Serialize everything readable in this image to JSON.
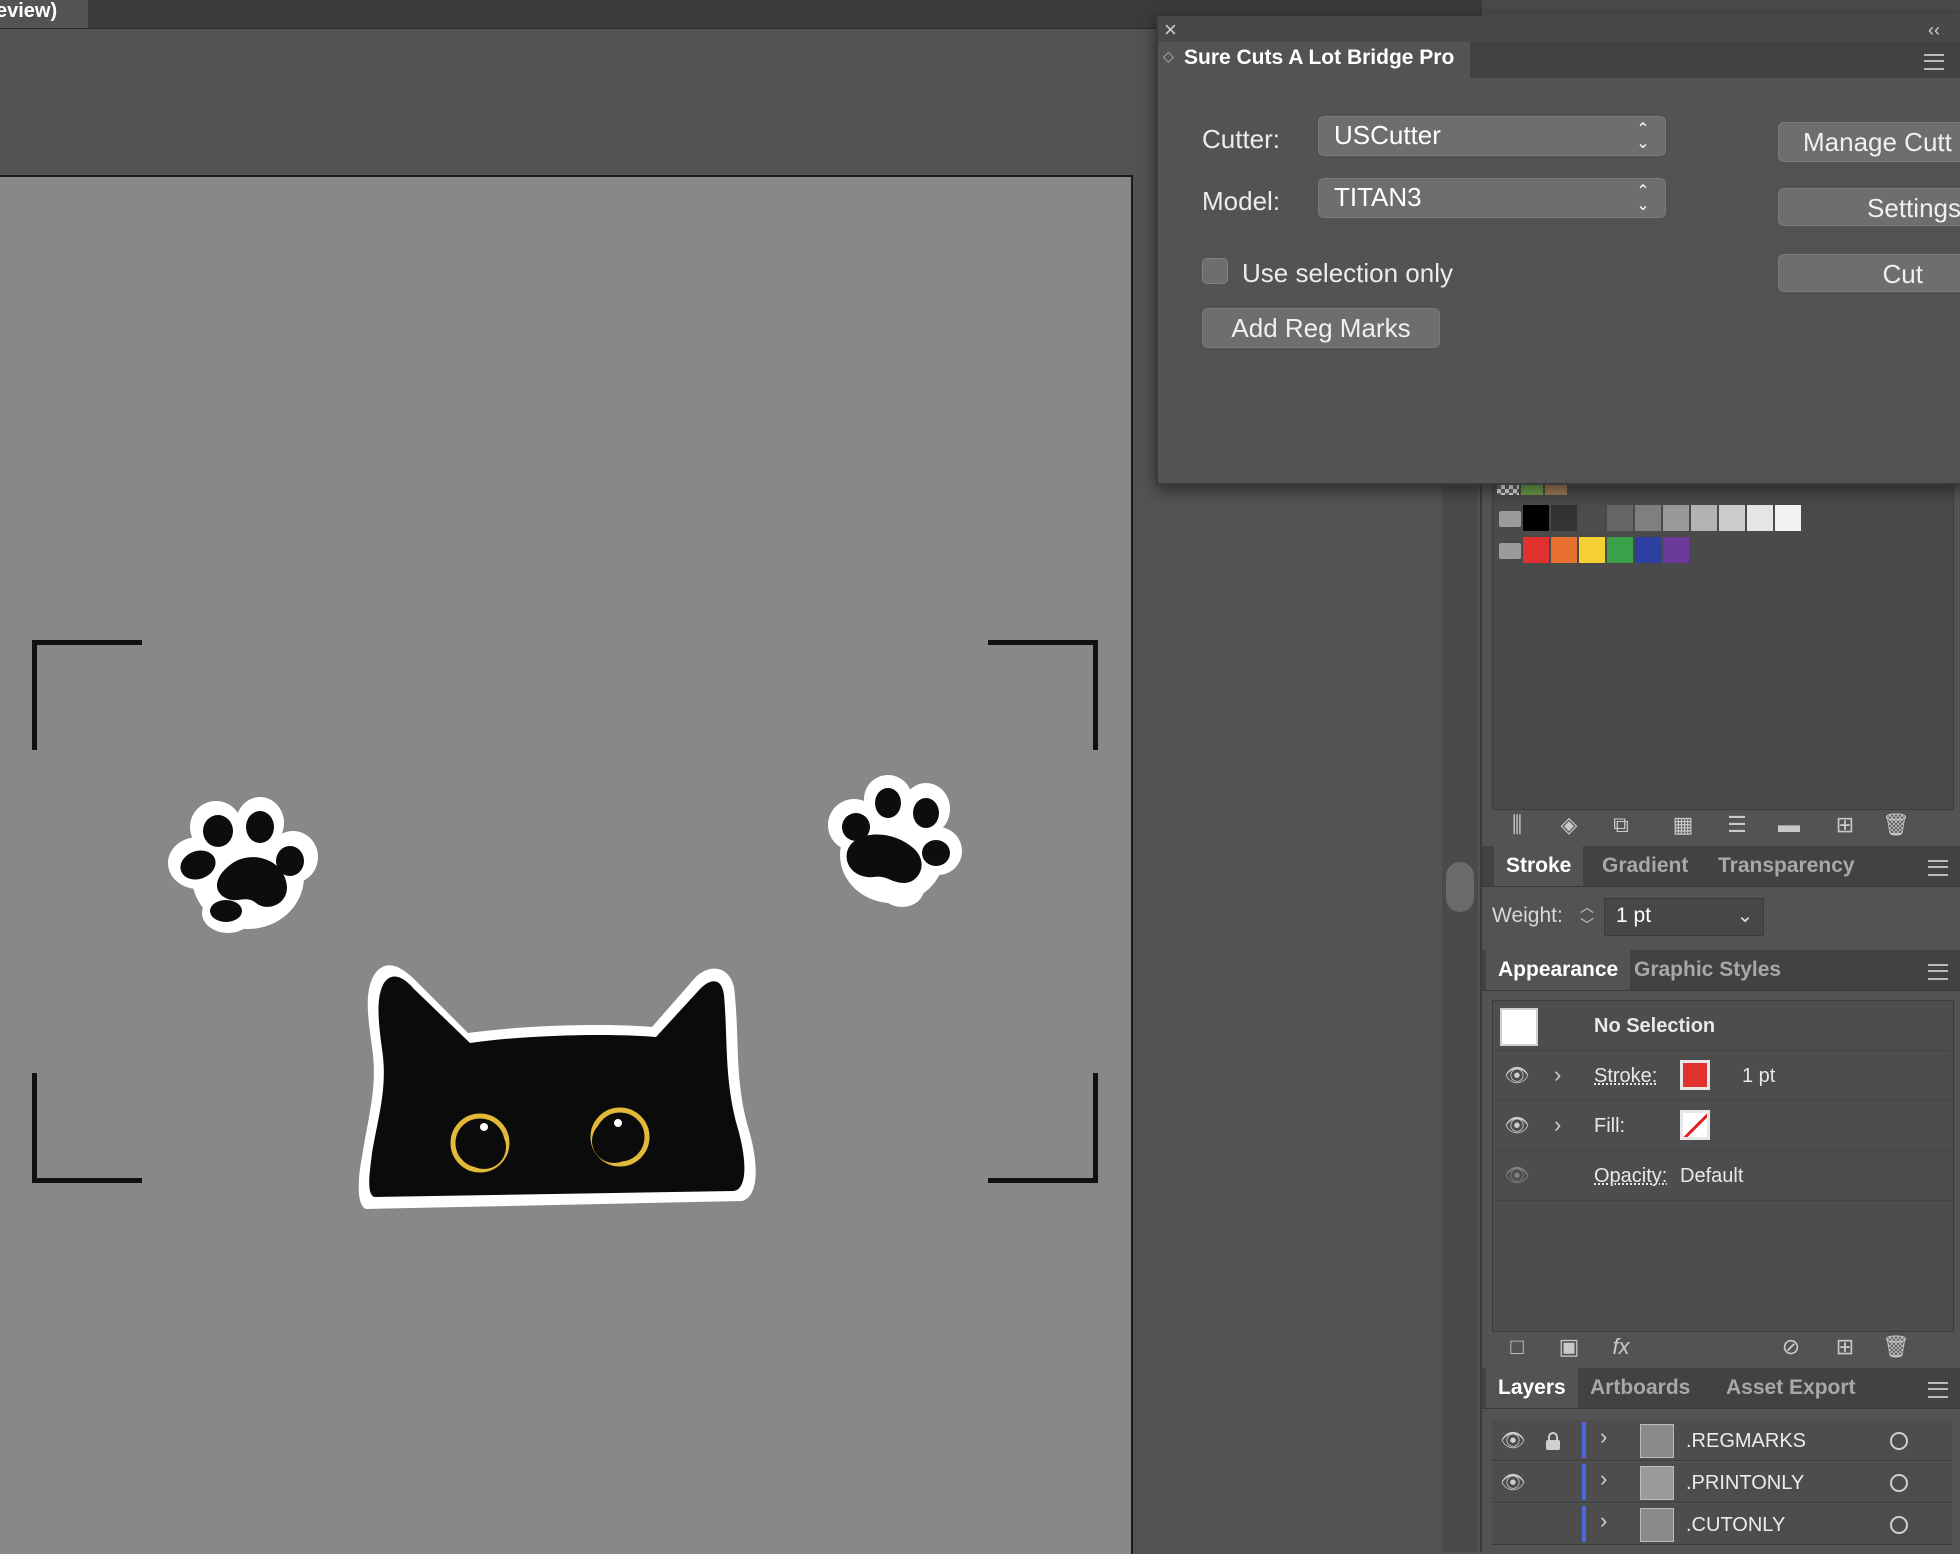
{
  "document": {
    "tab_title": "eview)"
  },
  "scal_panel": {
    "title": "Sure Cuts A Lot Bridge Pro",
    "cutter_label": "Cutter:",
    "cutter_value": "USCutter",
    "model_label": "Model:",
    "model_value": "TITAN3",
    "use_selection_label": "Use selection only",
    "use_selection_checked": false,
    "add_reg_marks_label": "Add Reg Marks",
    "manage_cutters_label": "Manage Cutt",
    "settings_label": "Settings",
    "cut_label": "Cut"
  },
  "swatches": {
    "row_grays": [
      "#000000",
      "#333333",
      "#4d4d4d",
      "#666666",
      "#7f7f7f",
      "#999999",
      "#b3b3b3",
      "#cccccc",
      "#e6e6e6",
      "#f2f2f2"
    ],
    "row_colors": [
      "#e0302f",
      "#e8702f",
      "#f5d033",
      "#3aa04a",
      "#2d3fa0",
      "#6b3a9b"
    ]
  },
  "stroke_panel": {
    "tabs": [
      "Stroke",
      "Gradient",
      "Transparency"
    ],
    "active_tab": "Stroke",
    "weight_label": "Weight:",
    "weight_value": "1 pt"
  },
  "appearance_panel": {
    "tabs": [
      "Appearance",
      "Graphic Styles"
    ],
    "active_tab": "Appearance",
    "header": "No Selection",
    "stroke_label": "Stroke:",
    "stroke_value": "1 pt",
    "stroke_color": "#e03030",
    "fill_label": "Fill:",
    "opacity_label": "Opacity:",
    "opacity_value": "Default"
  },
  "layers_panel": {
    "tabs": [
      "Layers",
      "Artboards",
      "Asset Export"
    ],
    "active_tab": "Layers",
    "layers": [
      {
        "name": ".REGMARKS",
        "visible": true,
        "locked": true
      },
      {
        "name": ".PRINTONLY",
        "visible": true,
        "locked": false
      },
      {
        "name": ".CUTONLY",
        "visible": false,
        "locked": false
      }
    ]
  }
}
